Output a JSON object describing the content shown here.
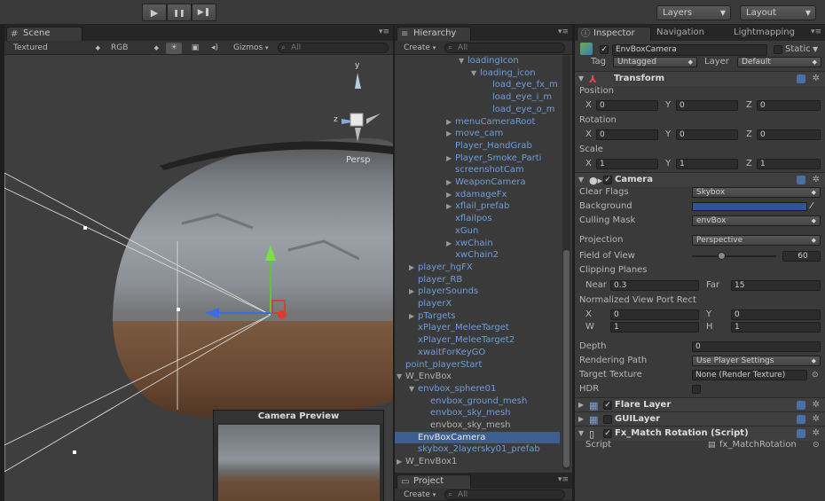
{
  "toolbar": {
    "play": "▶",
    "pause": "❚❚",
    "step": "▶❚",
    "layers": "Layers",
    "layout": "Layout"
  },
  "scene": {
    "tab": "Scene",
    "shading_mode": "Textured",
    "render_mode": "RGB",
    "gizmos": "Gizmos",
    "search_placeholder": "All",
    "persp_label": "Persp",
    "camera_preview_title": "Camera Preview"
  },
  "hierarchy": {
    "tab": "Hierarchy",
    "create": "Create",
    "search_placeholder": "All",
    "items": [
      {
        "label": "loadingIcon",
        "indent": 5,
        "tri": "▼",
        "style": "blue"
      },
      {
        "label": "loading_icon",
        "indent": 6,
        "tri": "▼",
        "style": "blue"
      },
      {
        "label": "load_eye_fx_m",
        "indent": 7,
        "tri": "",
        "style": "blue"
      },
      {
        "label": "load_eye_i_m",
        "indent": 7,
        "tri": "",
        "style": "blue"
      },
      {
        "label": "load_eye_o_m",
        "indent": 7,
        "tri": "",
        "style": "blue"
      },
      {
        "label": "menuCameraRoot",
        "indent": 4,
        "tri": "▶",
        "style": "blue"
      },
      {
        "label": "move_cam",
        "indent": 4,
        "tri": "▶",
        "style": "blue"
      },
      {
        "label": "Player_HandGrab",
        "indent": 4,
        "tri": "",
        "style": "blue"
      },
      {
        "label": "Player_Smoke_Parti",
        "indent": 4,
        "tri": "▶",
        "style": "blue"
      },
      {
        "label": "screenshotCam",
        "indent": 4,
        "tri": "",
        "style": "blue"
      },
      {
        "label": "WeaponCamera",
        "indent": 4,
        "tri": "▶",
        "style": "blue"
      },
      {
        "label": "xdamageFx",
        "indent": 4,
        "tri": "▶",
        "style": "blue"
      },
      {
        "label": "xflail_prefab",
        "indent": 4,
        "tri": "▶",
        "style": "blue"
      },
      {
        "label": "xflailpos",
        "indent": 4,
        "tri": "",
        "style": "blue"
      },
      {
        "label": "xGun",
        "indent": 4,
        "tri": "",
        "style": "blue"
      },
      {
        "label": "xwChain",
        "indent": 4,
        "tri": "▶",
        "style": "blue"
      },
      {
        "label": "xwChain2",
        "indent": 4,
        "tri": "",
        "style": "blue"
      },
      {
        "label": "player_hgFX",
        "indent": 1,
        "tri": "▶",
        "style": "blue"
      },
      {
        "label": "player_RB",
        "indent": 1,
        "tri": "",
        "style": "blue"
      },
      {
        "label": "playerSounds",
        "indent": 1,
        "tri": "▶",
        "style": "blue"
      },
      {
        "label": "playerX",
        "indent": 1,
        "tri": "",
        "style": "blue"
      },
      {
        "label": "pTargets",
        "indent": 1,
        "tri": "▶",
        "style": "blue"
      },
      {
        "label": "xPlayer_MeleeTarget",
        "indent": 1,
        "tri": "",
        "style": "blue"
      },
      {
        "label": "xPlayer_MeleeTarget2",
        "indent": 1,
        "tri": "",
        "style": "blue"
      },
      {
        "label": "xwaitForKeyGO",
        "indent": 1,
        "tri": "",
        "style": "blue"
      },
      {
        "label": "point_playerStart",
        "indent": 0,
        "tri": "",
        "style": "blue"
      },
      {
        "label": "W_EnvBox",
        "indent": 0,
        "tri": "▼",
        "style": "plain"
      },
      {
        "label": "envbox_sphere01",
        "indent": 1,
        "tri": "▼",
        "style": "blue"
      },
      {
        "label": "envbox_ground_mesh",
        "indent": 2,
        "tri": "",
        "style": "blue"
      },
      {
        "label": "envbox_sky_mesh",
        "indent": 2,
        "tri": "",
        "style": "blue"
      },
      {
        "label": "envbox_sky_mesh",
        "indent": 2,
        "tri": "",
        "style": "plain"
      },
      {
        "label": "EnvBoxCamera",
        "indent": 1,
        "tri": "",
        "style": "sel"
      },
      {
        "label": "skybox_2layersky01_prefab",
        "indent": 1,
        "tri": "",
        "style": "blue"
      },
      {
        "label": "W_EnvBox1",
        "indent": 0,
        "tri": "▶",
        "style": "plain"
      }
    ]
  },
  "project": {
    "tab": "Project",
    "create": "Create",
    "search_placeholder": "All"
  },
  "inspector": {
    "tabs": {
      "inspector": "Inspector",
      "navigation": "Navigation",
      "lightmapping": "Lightmapping"
    },
    "object_name": "EnvBoxCamera",
    "static_label": "Static",
    "tag_label": "Tag",
    "tag_value": "Untagged",
    "layer_label": "Layer",
    "layer_value": "Default",
    "transform": {
      "title": "Transform",
      "position_label": "Position",
      "position": {
        "x": "0",
        "y": "0",
        "z": "0"
      },
      "rotation_label": "Rotation",
      "rotation": {
        "x": "0",
        "y": "0",
        "z": "0"
      },
      "scale_label": "Scale",
      "scale": {
        "x": "1",
        "y": "1",
        "z": "1"
      }
    },
    "camera": {
      "title": "Camera",
      "clear_flags_label": "Clear Flags",
      "clear_flags": "Skybox",
      "background_label": "Background",
      "background_color": "#2f5597",
      "culling_mask_label": "Culling Mask",
      "culling_mask": "envBox",
      "projection_label": "Projection",
      "projection": "Perspective",
      "fov_label": "Field of View",
      "fov": "60",
      "fov_slider": 0.35,
      "clipping_label": "Clipping Planes",
      "near_label": "Near",
      "near": "0.3",
      "far_label": "Far",
      "far": "15",
      "viewport_label": "Normalized View Port Rect",
      "vp_x_label": "X",
      "vp_x": "0",
      "vp_y_label": "Y",
      "vp_y": "0",
      "vp_w_label": "W",
      "vp_w": "1",
      "vp_h_label": "H",
      "vp_h": "1",
      "depth_label": "Depth",
      "depth": "0",
      "rendering_path_label": "Rendering Path",
      "rendering_path": "Use Player Settings",
      "target_texture_label": "Target Texture",
      "target_texture": "None (Render Texture)",
      "hdr_label": "HDR"
    },
    "flare_layer": "Flare Layer",
    "gui_layer": "GUILayer",
    "fx_match": {
      "title": "Fx_Match Rotation (Script)",
      "script_label": "Script",
      "script_value": "fx_MatchRotation"
    }
  }
}
